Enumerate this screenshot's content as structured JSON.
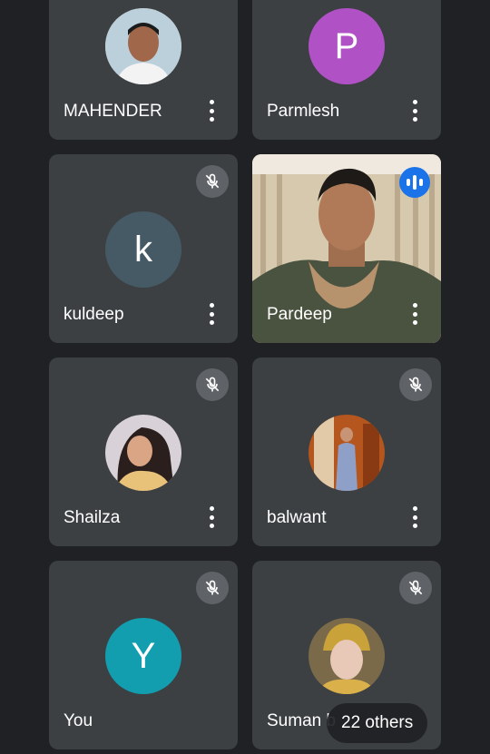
{
  "participants": [
    {
      "name": "MAHENDER",
      "avatar": "photo",
      "muted": false
    },
    {
      "name": "Parmlesh",
      "avatar": "letter",
      "letter": "P",
      "color": "#b052c5",
      "muted": false
    },
    {
      "name": "kuldeep",
      "avatar": "letter",
      "letter": "k",
      "color": "#455a64",
      "muted": true
    },
    {
      "name": "Pardeep",
      "avatar": "video",
      "speaking": true
    },
    {
      "name": "Shailza",
      "avatar": "photo",
      "muted": true
    },
    {
      "name": "balwant",
      "avatar": "photo",
      "muted": true
    },
    {
      "name": "You",
      "avatar": "letter",
      "letter": "Y",
      "color": "#129eaf",
      "muted": true
    },
    {
      "name": "Suman b",
      "avatar": "photo",
      "muted": true
    }
  ],
  "overflow": {
    "label": "22 others"
  },
  "icons": {
    "more": "more-vert-icon",
    "mute": "mic-off-icon",
    "speaking": "audio-level-icon"
  },
  "colors": {
    "background": "#202124",
    "tile": "#3c4043",
    "mute_badge": "#5f6368",
    "speaking_badge": "#1a73e8"
  }
}
